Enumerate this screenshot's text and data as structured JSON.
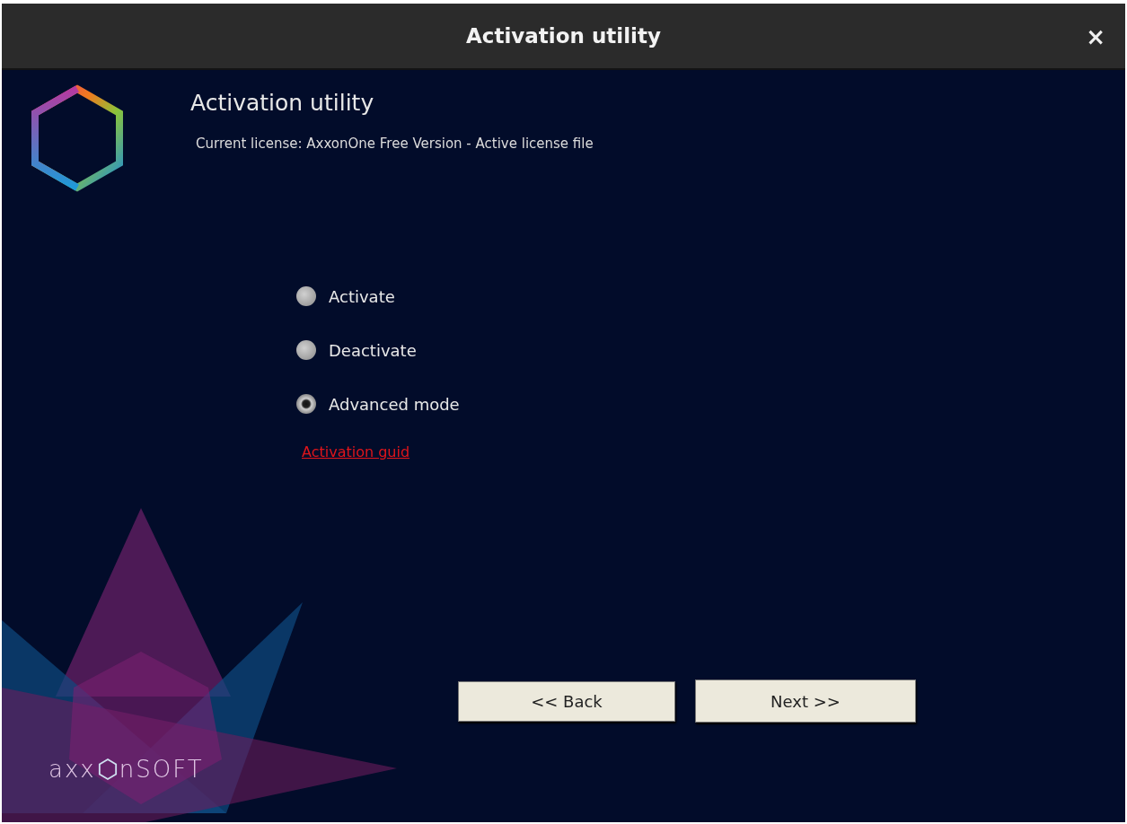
{
  "window": {
    "title": "Activation utility",
    "close": "×"
  },
  "header": {
    "title": "Activation utility",
    "license": "Current license: AxxonOne Free Version - Active license file"
  },
  "options": [
    {
      "label": "Activate",
      "selected": false
    },
    {
      "label": "Deactivate",
      "selected": false
    },
    {
      "label": "Advanced mode",
      "selected": true
    }
  ],
  "link": "Activation guid",
  "buttons": [
    "<< Back",
    "Next >>"
  ],
  "brand": {
    "before": "axx",
    "after": "nSOFT"
  }
}
